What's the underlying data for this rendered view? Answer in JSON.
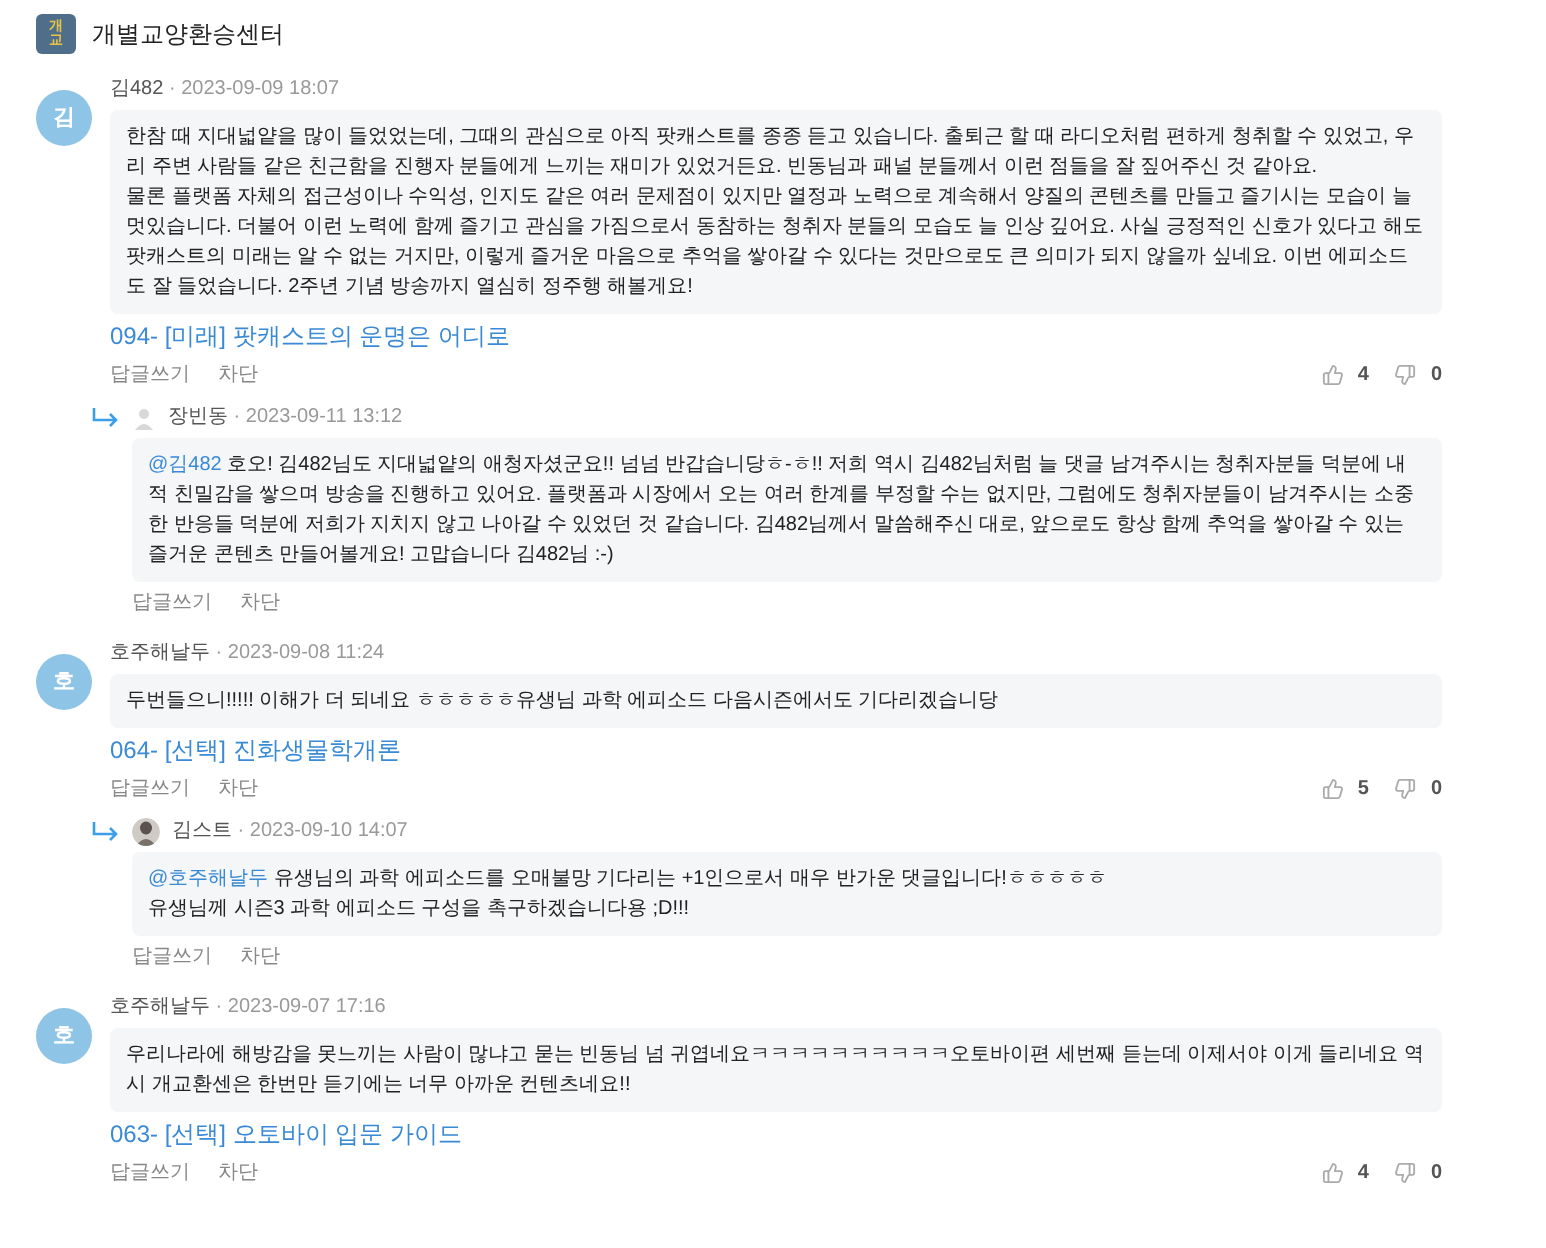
{
  "header": {
    "logo_text": "개교",
    "title": "개별교양환승센터"
  },
  "comments": [
    {
      "avatar": {
        "kind": "letter",
        "text": "김"
      },
      "author": "김482",
      "date": "· 2023-09-09 18:07",
      "text": "한참 때 지대넓얕을 많이 들었었는데, 그때의 관심으로 아직 팟캐스트를 종종 듣고 있습니다. 출퇴근 할 때 라디오처럼 편하게 청취할 수 있었고, 우리 주변 사람들 같은 친근함을 진행자 분들에게 느끼는 재미가 있었거든요. 빈동님과 패널 분들께서 이런 점들을 잘 짚어주신 것 같아요.\n물론 플랫폼 자체의 접근성이나 수익성, 인지도 같은 여러 문제점이 있지만 열정과 노력으로 계속해서 양질의 콘텐츠를 만들고 즐기시는 모습이 늘 멋있습니다. 더불어 이런 노력에 함께 즐기고 관심을 가짐으로서 동참하는 청취자 분들의 모습도 늘 인상 깊어요. 사실 긍정적인 신호가 있다고 해도 팟캐스트의 미래는 알 수 없는 거지만, 이렇게 즐거운 마음으로 추억을 쌓아갈 수 있다는 것만으로도 큰 의미가 되지 않을까 싶네요.  이번 에피소드도 잘 들었습니다. 2주년 기념 방송까지 열심히 정주행 해볼게요!",
      "episode": "094- [미래] 팟캐스트의 운명은 어디로",
      "actions": [
        "답글쓰기",
        "차단"
      ],
      "likes": "4",
      "dislikes": "0",
      "children": [
        {
          "avatar": {
            "kind": "silhouette"
          },
          "author": "장빈동",
          "date": "· 2023-09-11 13:12",
          "mention": "@김482",
          "text": " 호오! 김482님도 지대넓얕의 애청자셨군요!! 넘넘 반갑습니당ㅎ-ㅎ!! 저희 역시 김482님처럼 늘 댓글 남겨주시는 청취자분들 덕분에 내적 친밀감을 쌓으며 방송을 진행하고 있어요. 플랫폼과 시장에서 오는 여러 한계를 부정할 수는 없지만, 그럼에도 청취자분들이 남겨주시는 소중한 반응들 덕분에 저희가 지치지 않고 나아갈 수 있었던 것 같습니다. 김482님께서 말씀해주신 대로, 앞으로도 항상 함께 추억을 쌓아갈 수 있는 즐거운 콘텐츠 만들어볼게요! 고맙습니다 김482님 :-)",
          "actions": [
            "답글쓰기",
            "차단"
          ]
        }
      ]
    },
    {
      "avatar": {
        "kind": "letter",
        "text": "호"
      },
      "author": "호주해날두",
      "date": "· 2023-09-08 11:24",
      "text": "두번들으니!!!!! 이해가 더 되네요 ㅎㅎㅎㅎㅎ유생님 과학 에피소드 다음시즌에서도 기다리겠습니당",
      "episode": "064- [선택] 진화생물학개론",
      "actions": [
        "답글쓰기",
        "차단"
      ],
      "likes": "5",
      "dislikes": "0",
      "children": [
        {
          "avatar": {
            "kind": "picture"
          },
          "author": "김스트",
          "date": "· 2023-09-10 14:07",
          "mention": "@호주해날두",
          "text": " 유생님의 과학 에피소드를 오매불망 기다리는 +1인으로서 매우 반가운 댓글입니다!ㅎㅎㅎㅎㅎ\n유생님께 시즌3 과학 에피소드 구성을 촉구하겠습니다용 ;D!!!",
          "actions": [
            "답글쓰기",
            "차단"
          ]
        }
      ]
    },
    {
      "avatar": {
        "kind": "letter",
        "text": "호"
      },
      "author": "호주해날두",
      "date": "· 2023-09-07 17:16",
      "text": "우리나라에 해방감을 못느끼는 사람이 많냐고 묻는 빈동님 넘 귀엽네요ㅋㅋㅋㅋㅋㅋㅋㅋㅋㅋ오토바이편 세번째 듣는데 이제서야 이게 들리네요 역시 개교환센은 한번만 듣기에는 너무 아까운 컨텐츠네요!!",
      "episode": "063- [선택] 오토바이 입문 가이드",
      "actions": [
        "답글쓰기",
        "차단"
      ],
      "likes": "4",
      "dislikes": "0"
    }
  ]
}
